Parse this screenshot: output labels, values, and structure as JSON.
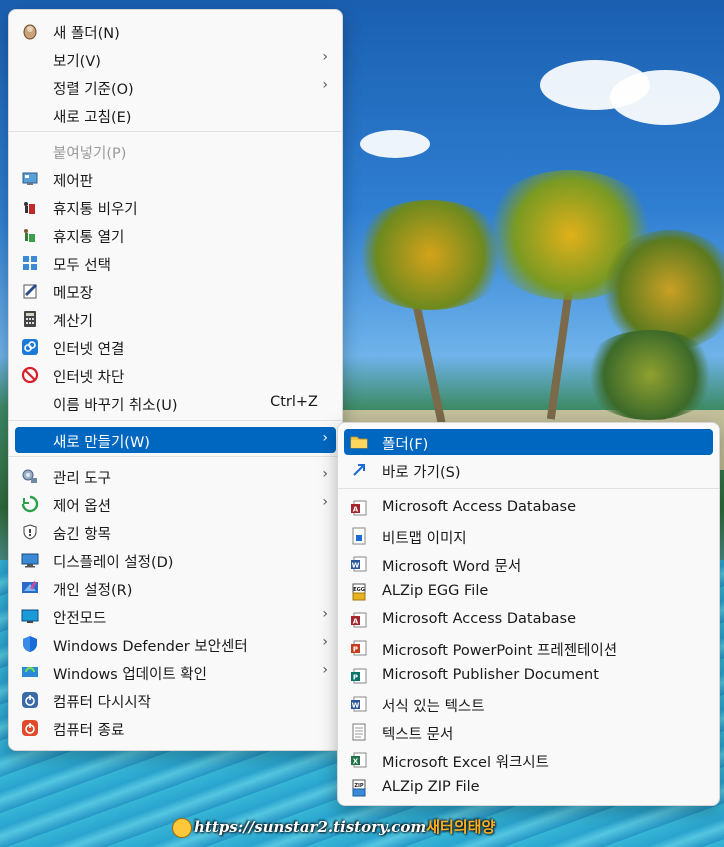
{
  "primary_menu": {
    "items": [
      {
        "label": "새 폴더(N)",
        "icon": "new-folder-icon"
      },
      {
        "label": "보기(V)",
        "submenu": true
      },
      {
        "label": "정렬 기준(O)",
        "submenu": true
      },
      {
        "label": "새로 고침(E)"
      },
      {
        "label": "붙여넣기(P)",
        "disabled": true
      },
      {
        "label": "제어판",
        "icon": "control-panel-icon"
      },
      {
        "label": "휴지통 비우기",
        "icon": "empty-recycle-bin-icon"
      },
      {
        "label": "휴지통 열기",
        "icon": "open-recycle-bin-icon"
      },
      {
        "label": "모두 선택",
        "icon": "select-all-icon"
      },
      {
        "label": "메모장",
        "icon": "notepad-icon"
      },
      {
        "label": "계산기",
        "icon": "calculator-icon"
      },
      {
        "label": "인터넷 연결",
        "icon": "internet-connect-icon"
      },
      {
        "label": "인터넷 차단",
        "icon": "internet-block-icon"
      },
      {
        "label": "이름 바꾸기 취소(U)",
        "shortcut": "Ctrl+Z"
      },
      {
        "label": "새로 만들기(W)",
        "submenu": true,
        "highlighted": true
      },
      {
        "label": "관리 도구",
        "icon": "admin-tools-icon",
        "submenu": true
      },
      {
        "label": "제어 옵션",
        "icon": "control-options-icon",
        "submenu": true
      },
      {
        "label": "숨긴 항목",
        "icon": "hidden-items-icon"
      },
      {
        "label": "디스플레이 설정(D)",
        "icon": "display-settings-icon"
      },
      {
        "label": "개인 설정(R)",
        "icon": "personalize-icon"
      },
      {
        "label": "안전모드",
        "icon": "safe-mode-icon",
        "submenu": true
      },
      {
        "label": "Windows Defender 보안센터",
        "icon": "defender-shield-icon",
        "submenu": true
      },
      {
        "label": "Windows 업데이트 확인",
        "icon": "windows-update-icon",
        "submenu": true
      },
      {
        "label": "컴퓨터 다시시작",
        "icon": "restart-icon"
      },
      {
        "label": "컴퓨터 종료",
        "icon": "shutdown-icon"
      }
    ]
  },
  "new_submenu": {
    "items": [
      {
        "label": "폴더(F)",
        "icon": "folder-icon",
        "highlighted": true
      },
      {
        "label": "바로 가기(S)",
        "icon": "shortcut-arrow-icon"
      },
      {
        "label": "Microsoft Access Database",
        "icon": "access-database-icon"
      },
      {
        "label": "비트맵 이미지",
        "icon": "bitmap-image-icon"
      },
      {
        "label": "Microsoft Word 문서",
        "icon": "word-document-icon"
      },
      {
        "label": "ALZip EGG File",
        "icon": "alzip-egg-icon"
      },
      {
        "label": "Microsoft Access Database",
        "icon": "access-database-icon"
      },
      {
        "label": "Microsoft PowerPoint 프레젠테이션",
        "icon": "powerpoint-icon"
      },
      {
        "label": "Microsoft Publisher Document",
        "icon": "publisher-icon"
      },
      {
        "label": "서식 있는 텍스트",
        "icon": "rich-text-icon"
      },
      {
        "label": "텍스트 문서",
        "icon": "text-document-icon"
      },
      {
        "label": "Microsoft Excel 워크시트",
        "icon": "excel-icon"
      },
      {
        "label": "ALZip ZIP File",
        "icon": "alzip-zip-icon"
      }
    ]
  },
  "watermark": {
    "url": "https://sunstar2.tistory.com",
    "name": "새터의태양"
  },
  "colors": {
    "highlight": "#0067c0",
    "menu_bg": "#f9f9f9"
  }
}
